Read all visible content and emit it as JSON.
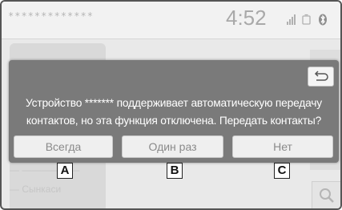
{
  "status": {
    "device_name_masked": "*************",
    "time": "4:52"
  },
  "background": {
    "row1": "— ——————",
    "row2": "— Сынкаси"
  },
  "dialog": {
    "message_line1": "Устройство ******* поддерживает автоматическую передачу",
    "message_line2": "контактов, но эта функция отключена. Передать контакты?",
    "buttons": [
      {
        "label": "Всегда",
        "callout": "A"
      },
      {
        "label": "Один раз",
        "callout": "B"
      },
      {
        "label": "Нет",
        "callout": "C"
      }
    ]
  },
  "icons": {
    "back": "back-arrow-icon",
    "signal": "signal-bars-icon",
    "battery": "battery-icon",
    "bluetooth": "bluetooth-icon",
    "search": "search-icon"
  }
}
